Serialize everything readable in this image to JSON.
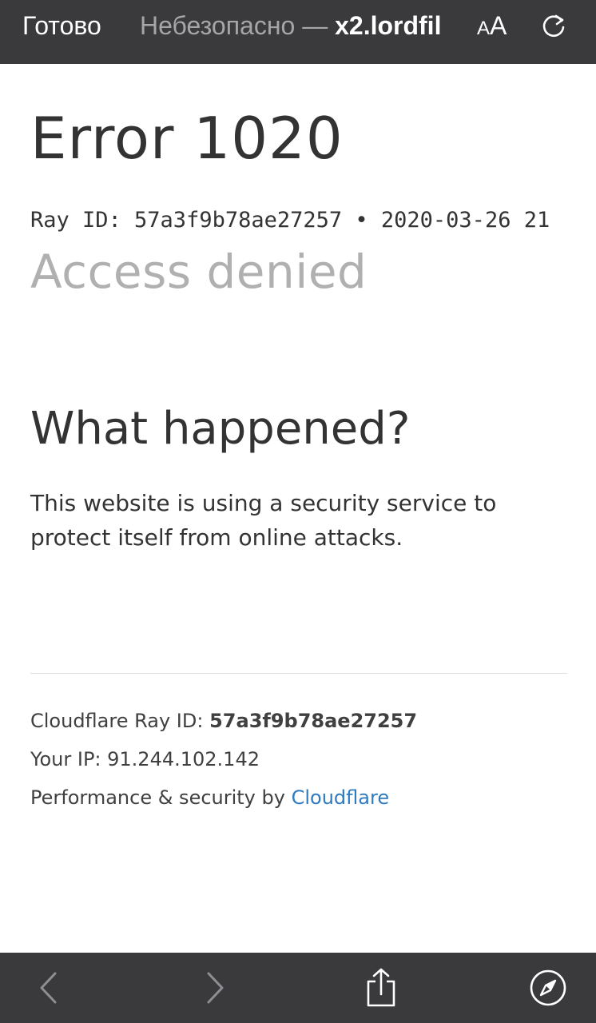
{
  "browser": {
    "done_label": "Готово",
    "url_insecure_label": "Небезопасно —",
    "url_domain": "x2.lordfil",
    "aa_small": "A",
    "aa_large": "A",
    "reload_icon": "reload-icon",
    "accent_color": "#3a3a3c"
  },
  "content": {
    "error_title": "Error 1020",
    "ray_line": "Ray ID: 57a3f9b78ae27257 • 2020-03-26 21",
    "access_denied": "Access denied",
    "what_happened": "What happened?",
    "explanation": "This website is using a security service to protect itself from online attacks."
  },
  "footer": {
    "ray_label": "Cloudflare Ray ID:",
    "ray_value": "57a3f9b78ae27257",
    "ip_label": "Your IP:",
    "ip_value": "91.244.102.142",
    "perf_label": "Performance & security by",
    "perf_link": "Cloudflare",
    "link_color": "#2f7bbf"
  },
  "toolbar": {
    "back_icon": "chevron-left-icon",
    "forward_icon": "chevron-right-icon",
    "share_icon": "share-icon",
    "compass_icon": "compass-icon"
  }
}
